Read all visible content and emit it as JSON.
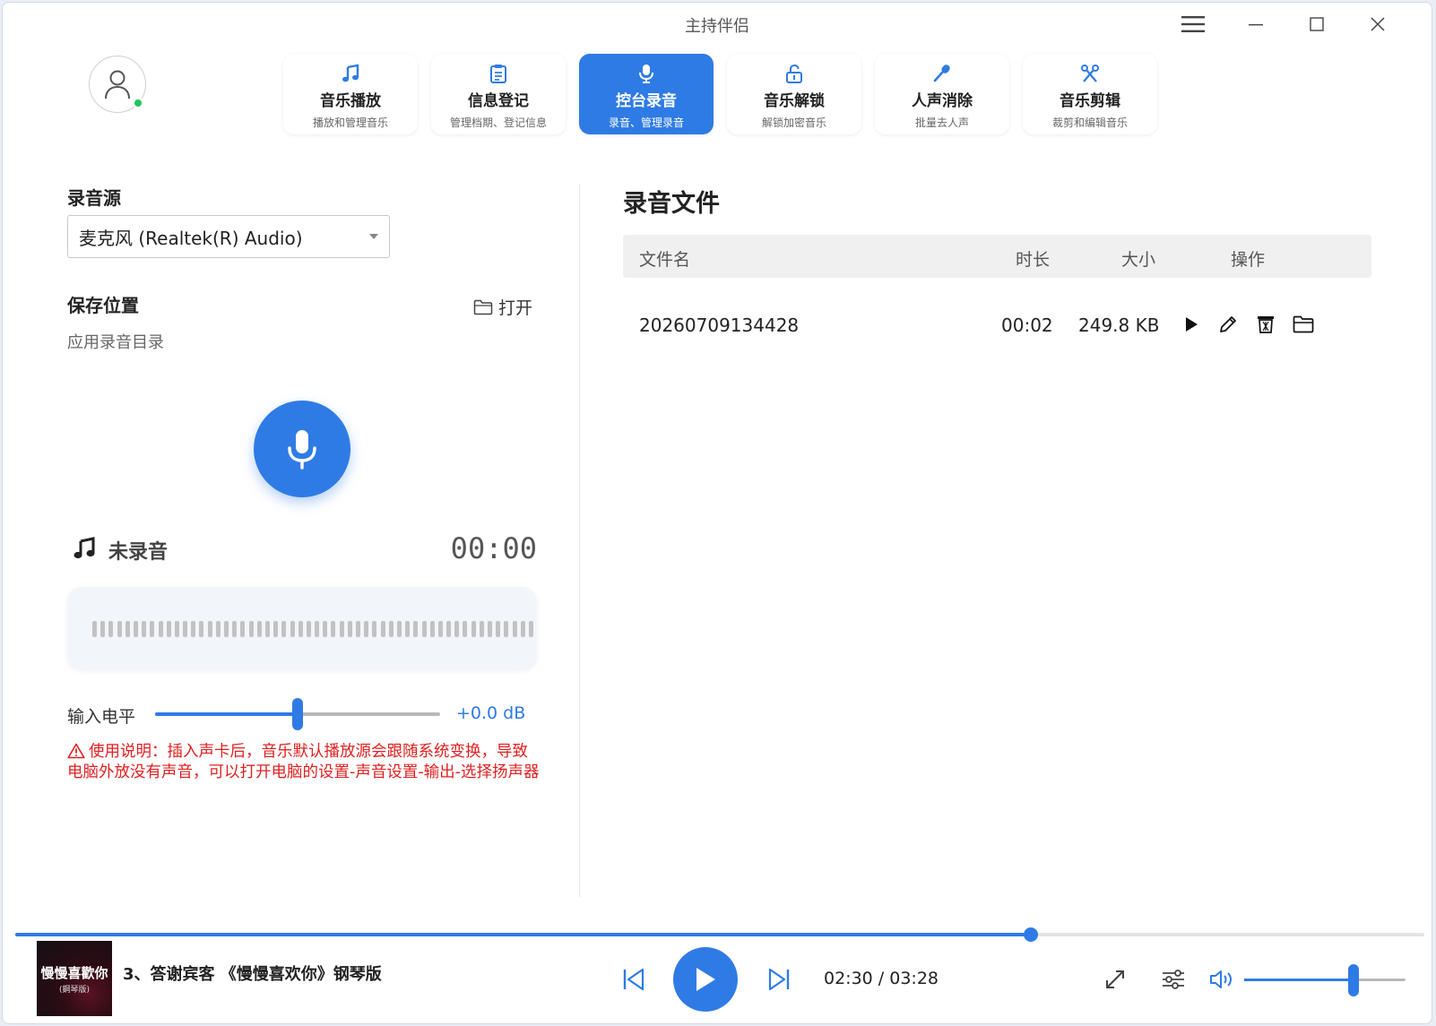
{
  "window": {
    "title": "主持伴侣"
  },
  "nav": {
    "tabs": [
      {
        "label": "音乐播放",
        "sub": "播放和管理音乐",
        "icon": "music-note-icon"
      },
      {
        "label": "信息登记",
        "sub": "管理档期、登记信息",
        "icon": "clipboard-icon"
      },
      {
        "label": "控台录音",
        "sub": "录音、管理录音",
        "icon": "microphone-icon",
        "active": true
      },
      {
        "label": "音乐解锁",
        "sub": "解锁加密音乐",
        "icon": "unlock-icon"
      },
      {
        "label": "人声消除",
        "sub": "批量去人声",
        "icon": "mic-pen-icon"
      },
      {
        "label": "音乐剪辑",
        "sub": "裁剪和编辑音乐",
        "icon": "scissors-icon"
      }
    ]
  },
  "recorder": {
    "source_label": "录音源",
    "source_value": "麦克风 (Realtek(R) Audio)",
    "save_label": "保存位置",
    "open_label": "打开",
    "save_dir": "应用录音目录",
    "status": "未录音",
    "timer": "00:00",
    "level_label": "输入电平",
    "level_value": "+0.0 dB",
    "level_fraction": 0.5,
    "warning": "使用说明：插入声卡后，音乐默认播放源会跟随系统变换，导致电脑外放没有声音，可以打开电脑的设置-声音设置-输出-选择扬声器"
  },
  "files": {
    "title": "录音文件",
    "columns": {
      "name": "文件名",
      "duration": "时长",
      "size": "大小",
      "actions": "操作"
    },
    "rows": [
      {
        "name": "20260709134428",
        "duration": "00:02",
        "size": "249.8 KB"
      }
    ]
  },
  "player": {
    "album_title": "慢慢喜歡你",
    "album_sub": "(鋼琴版)",
    "song": "3、答谢宾客  《慢慢喜欢你》钢琴版",
    "time": "02:30 / 03:28",
    "progress_fraction": 0.7207,
    "volume_fraction": 0.68
  },
  "colors": {
    "accent": "#2f7be5",
    "warning": "#e02020",
    "online": "#22c55e"
  }
}
